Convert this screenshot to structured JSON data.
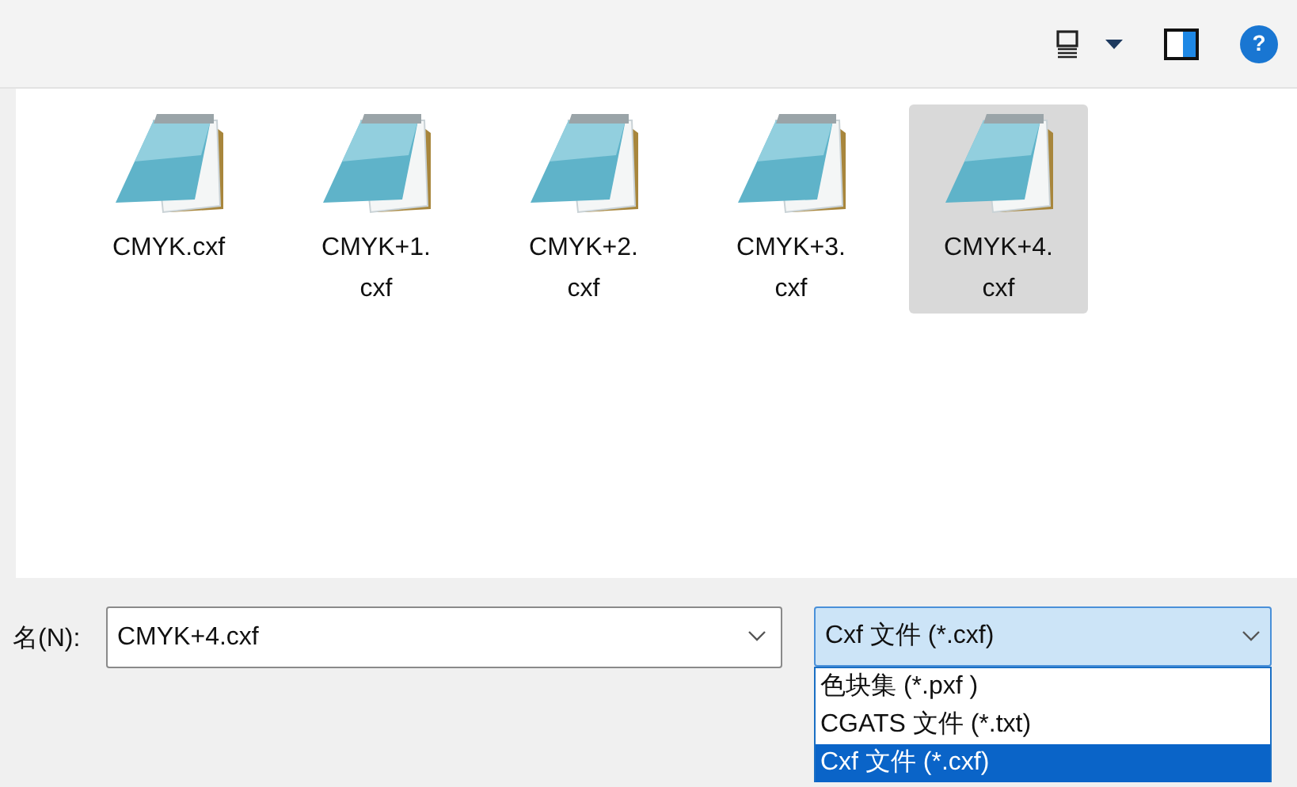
{
  "files": [
    {
      "name": "CMYK.cxf",
      "selected": false
    },
    {
      "name": "CMYK+1.cxf",
      "selected": false
    },
    {
      "name": "CMYK+2.cxf",
      "selected": false
    },
    {
      "name": "CMYK+3.cxf",
      "selected": false
    },
    {
      "name": "CMYK+4.cxf",
      "selected": true
    }
  ],
  "help": {
    "label": "?"
  },
  "filename": {
    "label": "名(N):",
    "value": "CMYK+4.cxf"
  },
  "filetype": {
    "value": "Cxf 文件 (*.cxf)",
    "expanded": true,
    "options": [
      {
        "label": "色块集 (*.pxf )",
        "selected": false
      },
      {
        "label": "CGATS 文件 (*.txt)",
        "selected": false
      },
      {
        "label": "Cxf 文件 (*.cxf)",
        "selected": true
      }
    ]
  }
}
